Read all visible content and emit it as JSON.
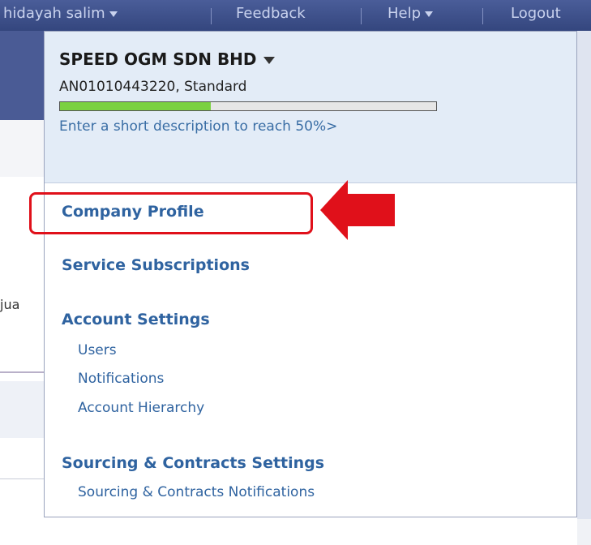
{
  "topbar": {
    "user": "hidayah salim",
    "feedback": "Feedback",
    "help": "Help",
    "logout": "Logout"
  },
  "background": {
    "fragment": "jua"
  },
  "dropdown": {
    "company": "SPEED OGM SDN BHD",
    "account": "AN01010443220, Standard",
    "profile_progress": 0.4,
    "progress_text": "Enter a short description to reach 50%>",
    "company_profile": "Company Profile",
    "service_subscriptions": "Service Subscriptions",
    "account_settings": {
      "title": "Account Settings",
      "items": [
        "Users",
        "Notifications",
        "Account Hierarchy"
      ]
    },
    "sourcing_settings": {
      "title": "Sourcing & Contracts Settings",
      "items": [
        "Sourcing & Contracts Notifications"
      ]
    }
  },
  "colors": {
    "highlight": "#e0101a",
    "link": "#2f63a0",
    "progress_fill": "#7bd141"
  }
}
